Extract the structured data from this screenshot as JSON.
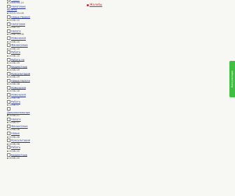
{
  "ad_link": {
    "label": "Жалобы"
  },
  "side_tab": {
    "label": "Консультация"
  },
  "entries": [
    {
      "title": "Новые",
      "date": "2010-03-10"
    },
    {
      "title": "Налоговые вычеты",
      "date": "2010-03-08"
    },
    {
      "title": "Новые Правил",
      "date": "2008-10"
    },
    {
      "title": "Налоговая",
      "date": "2008-10"
    },
    {
      "title": "Налоги",
      "date": "2008-10-06"
    },
    {
      "title": "Изменения",
      "date": "2008-10"
    },
    {
      "title": "Финансовые",
      "date": "2008-10"
    },
    {
      "title": "Работа",
      "date": "2008-10"
    },
    {
      "title": "Работа по",
      "date": "2008-09"
    },
    {
      "title": "Бюджетные",
      "date": "2008-09"
    },
    {
      "title": "Консультации",
      "date": "2008-09"
    },
    {
      "title": "Новые Налоги",
      "date": "2008-08"
    },
    {
      "title": "Изменения",
      "date": "2008-08"
    },
    {
      "title": "Изменения",
      "date": "2008-08"
    },
    {
      "title": "Работа",
      "date": "2008-07"
    },
    {
      "title": "Дополнительные",
      "date": "2008-07"
    },
    {
      "title": "Налоги",
      "date": "2008-07"
    },
    {
      "title": "Финансовые",
      "date": "2008-06"
    },
    {
      "title": "Новые",
      "date": "2008-06"
    },
    {
      "title": "Консультации",
      "date": "2008-06"
    },
    {
      "title": "Работа",
      "date": "2008-05"
    },
    {
      "title": "Бюджетные",
      "date": "2008-05"
    }
  ]
}
